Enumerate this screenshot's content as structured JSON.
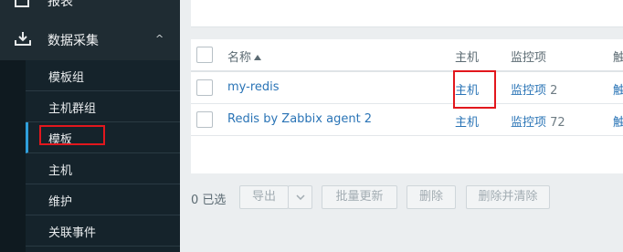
{
  "sidebar": {
    "top_item_label": "报表",
    "section_label": "数据采集",
    "items": [
      {
        "label": "模板组"
      },
      {
        "label": "主机群组"
      },
      {
        "label": "模板"
      },
      {
        "label": "主机"
      },
      {
        "label": "维护"
      },
      {
        "label": "关联事件"
      }
    ],
    "selected_item": "模板"
  },
  "table": {
    "headers": {
      "name": "名称",
      "hosts": "主机",
      "items": "监控项",
      "triggers": "触"
    },
    "rows": [
      {
        "name": "my-redis",
        "hosts": "主机",
        "items": "监控项",
        "items_count": "2",
        "triggers": "触"
      },
      {
        "name": "Redis by Zabbix agent 2",
        "hosts": "主机",
        "items": "监控项",
        "items_count": "72",
        "triggers": "触"
      }
    ]
  },
  "footer": {
    "selected": "0 已选",
    "export": "导出",
    "mass_update": "批量更新",
    "delete": "删除",
    "delete_clear": "删除并清除"
  },
  "annotation_color": "#e2171d"
}
